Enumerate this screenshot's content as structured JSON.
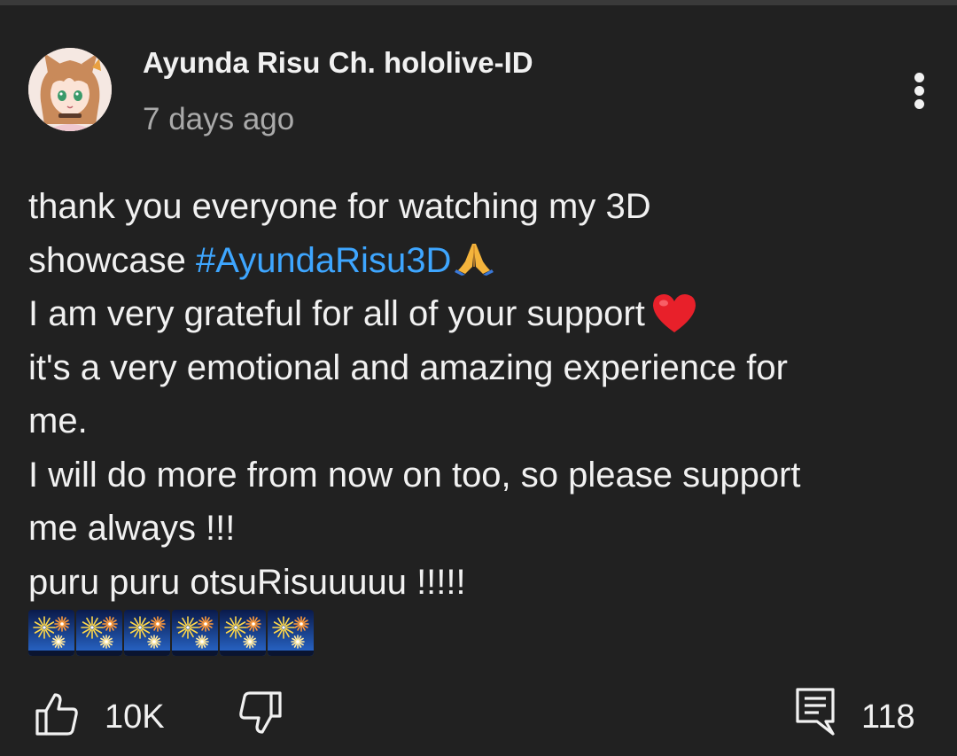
{
  "post": {
    "channel_name": "Ayunda Risu Ch. hololive-ID",
    "time_ago": "7 days ago",
    "avatar_icon": "avatar-image",
    "more_icon": "more-vertical-icon",
    "body": {
      "line1": "thank you everyone for watching my 3D",
      "line2_text": "showcase ",
      "line2_hashtag": "#AyundaRisu3D",
      "line2_emoji": "folded-hands-emoji",
      "line3_text": "I am very grateful for all of your support",
      "line3_emoji": "red-heart-emoji",
      "line4": "it's a very emotional and amazing experience for",
      "line5": "me.",
      "line6": "I will do more from now on too, so please support",
      "line7": "me always !!!",
      "line8": "puru puru otsuRisuuuuu !!!!!",
      "fireworks_emoji": "fireworks-emoji",
      "fireworks_count": 6
    },
    "actions": {
      "like_icon": "thumbs-up-icon",
      "like_count": "10K",
      "dislike_icon": "thumbs-down-icon",
      "comment_icon": "comment-icon",
      "comment_count": "118"
    },
    "colors": {
      "background": "#212121",
      "text": "#f1f1f1",
      "secondary_text": "#aaaaaa",
      "hashtag": "#3ea6ff"
    }
  }
}
